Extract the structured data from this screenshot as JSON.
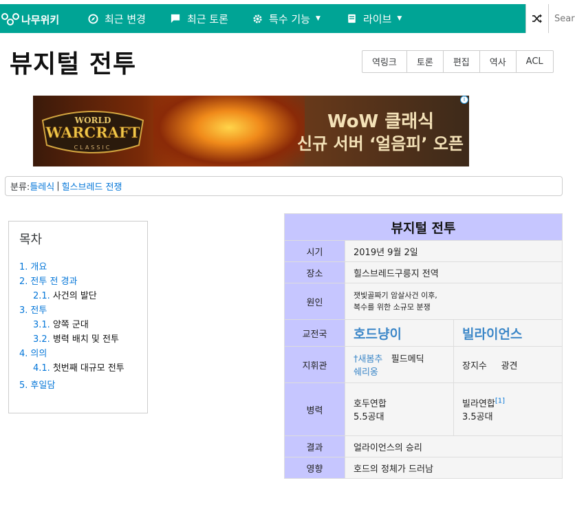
{
  "nav": {
    "logo": "나무위키",
    "items": [
      {
        "label": "최근 변경",
        "icon": "compass-icon"
      },
      {
        "label": "최근 토론",
        "icon": "comment-icon"
      },
      {
        "label": "특수 기능",
        "icon": "gear-icon"
      },
      {
        "label": "라이브",
        "icon": "book-icon"
      }
    ],
    "search_placeholder": "Search"
  },
  "page": {
    "title": "뷰지털 전투",
    "tools": [
      "역링크",
      "토론",
      "편집",
      "역사",
      "ACL"
    ]
  },
  "ad": {
    "logo_line1": "WORLD",
    "logo_line2": "WARCRAFT",
    "logo_line3": "CLASSIC",
    "line1": "WoW 클래식",
    "line2": "신규 서버 ‘얼음피’ 오픈",
    "info": "i"
  },
  "category": {
    "label": "분류:",
    "links": [
      "틀레식",
      "힐스브레드 전쟁"
    ],
    "separator": "|"
  },
  "toc": {
    "title": "목차",
    "items": [
      {
        "num": "1.",
        "text": "개요"
      },
      {
        "num": "2.",
        "text": "전투 전 경과"
      },
      {
        "num": "2.1.",
        "text": "사건의 발단"
      },
      {
        "num": "3.",
        "text": "전투"
      },
      {
        "num": "3.1.",
        "text": "양쪽 군대"
      },
      {
        "num": "3.2.",
        "text": "병력 배치 및 전투"
      },
      {
        "num": "4.",
        "text": "의의"
      },
      {
        "num": "4.1.",
        "text": "첫번째 대규모 전투"
      },
      {
        "num": "5.",
        "text": "후일담"
      }
    ]
  },
  "infobox": {
    "title": "뷰지털 전투",
    "time_key": "시기",
    "time_val": "2019년  9월  2일",
    "place_key": "장소",
    "place_val": "힐스브레드구릉지 전역",
    "cause_key": "원인",
    "cause_val1": "잿빛골짜기 암살사건 이후,",
    "cause_val2": "복수를 위한 소규모 분쟁",
    "belligerents_key": "교전국",
    "horde": "호드냥이",
    "alliance": "빌라이언스",
    "commander_key": "지휘관",
    "horde_cmd1": "†새봄추",
    "horde_cmd2": "필드메딕",
    "horde_cmd3": "쉐리옹",
    "alliance_cmd1": "장지수",
    "alliance_cmd2": "광견",
    "strength_key": "병력",
    "horde_str1": "호두연합",
    "horde_str2": "5.5공대",
    "alliance_str1": "빌라연합",
    "alliance_str_note": "[1]",
    "alliance_str2": "3.5공대",
    "result_key": "결과",
    "result_val": "얼라이언스의 승리",
    "effect_key": "영향",
    "effect_val": "호드의 정체가 드러남"
  }
}
